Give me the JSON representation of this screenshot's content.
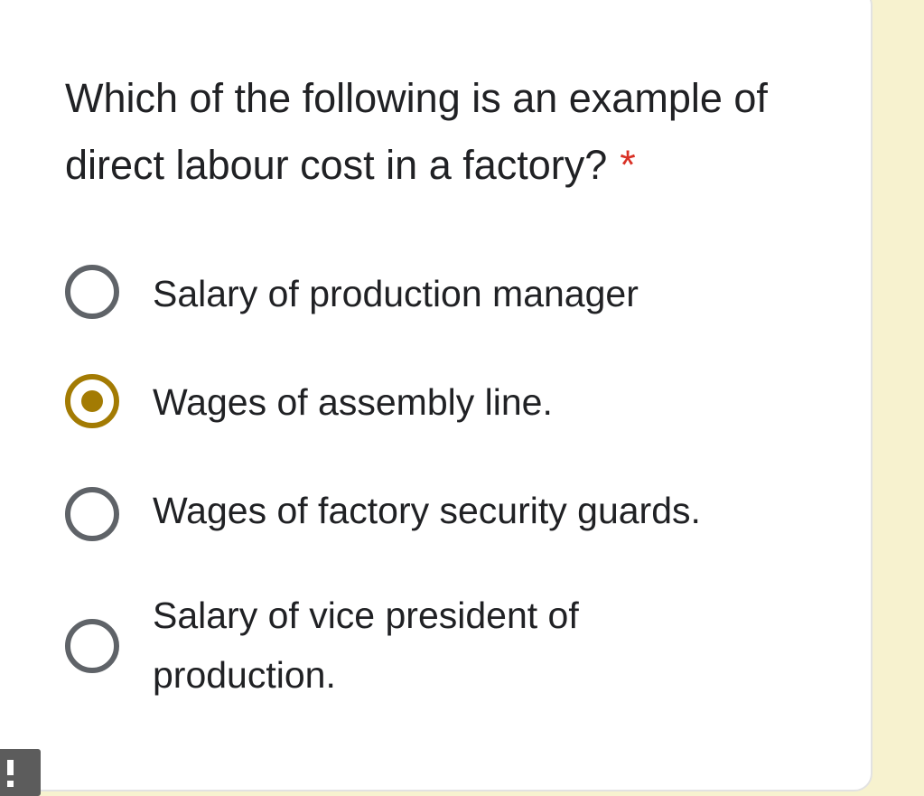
{
  "question": {
    "text": "Which of the following is an example of direct labour cost in a factory?",
    "required_mark": "*"
  },
  "options": [
    {
      "label": "Salary of production manager",
      "selected": false
    },
    {
      "label": "Wages of assembly line.",
      "selected": true
    },
    {
      "label": "Wages of factory security guards.",
      "selected": false
    },
    {
      "label": "Salary of vice president of production.",
      "selected": false
    }
  ],
  "colors": {
    "accent": "#a37b03",
    "required": "#d93025",
    "radio_border": "#5f6368",
    "background": "#f7f2cf",
    "alert": "#5c5c5c"
  },
  "alert_icon": "exclamation-icon"
}
